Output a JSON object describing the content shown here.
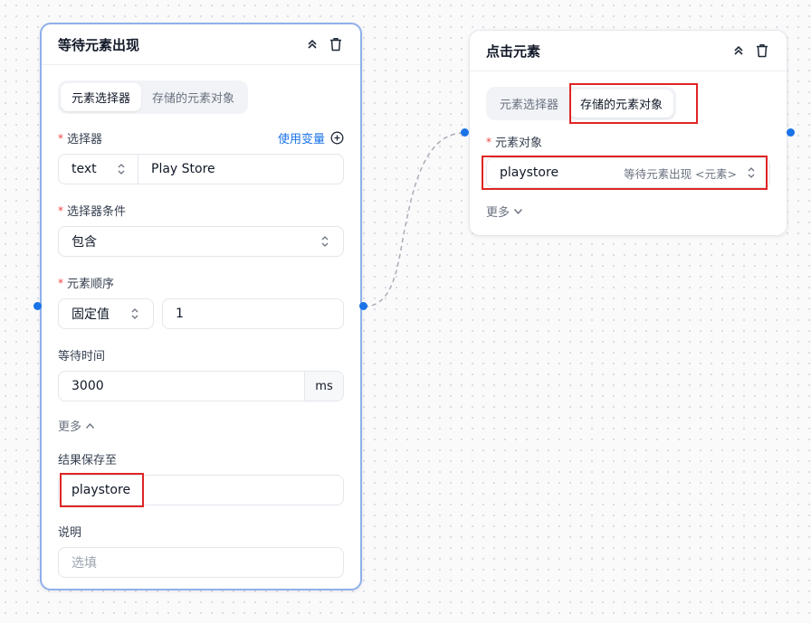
{
  "node_wait": {
    "title": "等待元素出现",
    "tabs": [
      "元素选择器",
      "存储的元素对象"
    ],
    "active_tab": 0,
    "selector": {
      "label": "选择器",
      "use_variable": "使用变量",
      "type_value": "text",
      "value": "Play Store"
    },
    "selector_condition": {
      "label": "选择器条件",
      "value": "包含"
    },
    "element_order": {
      "label": "元素顺序",
      "mode": "固定值",
      "value": "1"
    },
    "wait_time": {
      "label": "等待时间",
      "value": "3000",
      "unit": "ms"
    },
    "more": "更多",
    "save_result": {
      "label": "结果保存至",
      "value": "playstore"
    },
    "description": {
      "label": "说明",
      "placeholder": "选填"
    }
  },
  "node_click": {
    "title": "点击元素",
    "tabs": [
      "元素选择器",
      "存储的元素对象"
    ],
    "active_tab": 1,
    "element_object": {
      "label": "元素对象",
      "value": "playstore",
      "source": "等待元素出现 <元素>"
    },
    "more": "更多"
  },
  "colors": {
    "accent": "#1a73e8",
    "selected_border": "#8fb0ea",
    "highlight": "#e02424",
    "required": "#ef4444"
  }
}
